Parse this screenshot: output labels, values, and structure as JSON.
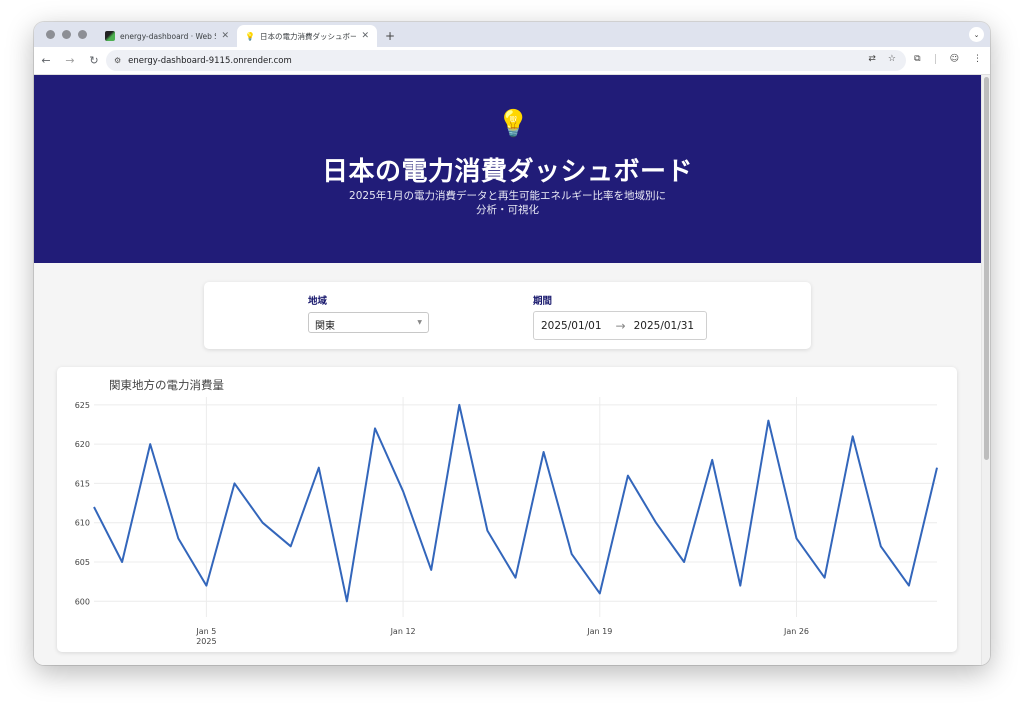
{
  "browser": {
    "tabs": [
      {
        "title": "energy-dashboard · Web Se",
        "active": false
      },
      {
        "title": "日本の電力消費ダッシュボード",
        "active": true
      }
    ],
    "new_tab": "+",
    "url": "energy-dashboard-9115.onrender.com"
  },
  "hero": {
    "icon": "light-bulb-icon",
    "emoji": "💡",
    "title": "日本の電力消費ダッシュボード",
    "subtitle_line1": "2025年1月の電力消費データと再生可能エネルギー比率を地域別に",
    "subtitle_line2": "分析・可視化",
    "background": "#211c78"
  },
  "filters": {
    "region_label": "地域",
    "region_value": "関東",
    "period_label": "期間",
    "start_date": "2025/01/01",
    "end_date": "2025/01/31",
    "arrow": "→"
  },
  "chart_data": {
    "type": "line",
    "title": "関東地方の電力消費量",
    "xlabel": "",
    "ylabel": "",
    "line_color": "#3366bb",
    "x": [
      "2025-01-01",
      "2025-01-02",
      "2025-01-03",
      "2025-01-04",
      "2025-01-05",
      "2025-01-06",
      "2025-01-07",
      "2025-01-08",
      "2025-01-09",
      "2025-01-10",
      "2025-01-11",
      "2025-01-12",
      "2025-01-13",
      "2025-01-14",
      "2025-01-15",
      "2025-01-16",
      "2025-01-17",
      "2025-01-18",
      "2025-01-19",
      "2025-01-20",
      "2025-01-21",
      "2025-01-22",
      "2025-01-23",
      "2025-01-24",
      "2025-01-25",
      "2025-01-26",
      "2025-01-27",
      "2025-01-28",
      "2025-01-29",
      "2025-01-30",
      "2025-01-31"
    ],
    "values": [
      612,
      605,
      620,
      608,
      602,
      615,
      610,
      607,
      617,
      600,
      622,
      614,
      604,
      625,
      609,
      603,
      619,
      606,
      601,
      616,
      610,
      605,
      618,
      602,
      623,
      608,
      603,
      621,
      607,
      602,
      617
    ],
    "ylim": [
      598,
      626
    ],
    "y_ticks": [
      600,
      605,
      610,
      615,
      620,
      625
    ],
    "x_ticks": [
      {
        "date": "2025-01-05",
        "label": "Jan 5",
        "sublabel": "2025"
      },
      {
        "date": "2025-01-12",
        "label": "Jan 12",
        "sublabel": ""
      },
      {
        "date": "2025-01-19",
        "label": "Jan 19",
        "sublabel": ""
      },
      {
        "date": "2025-01-26",
        "label": "Jan 26",
        "sublabel": ""
      }
    ],
    "grid": true
  }
}
